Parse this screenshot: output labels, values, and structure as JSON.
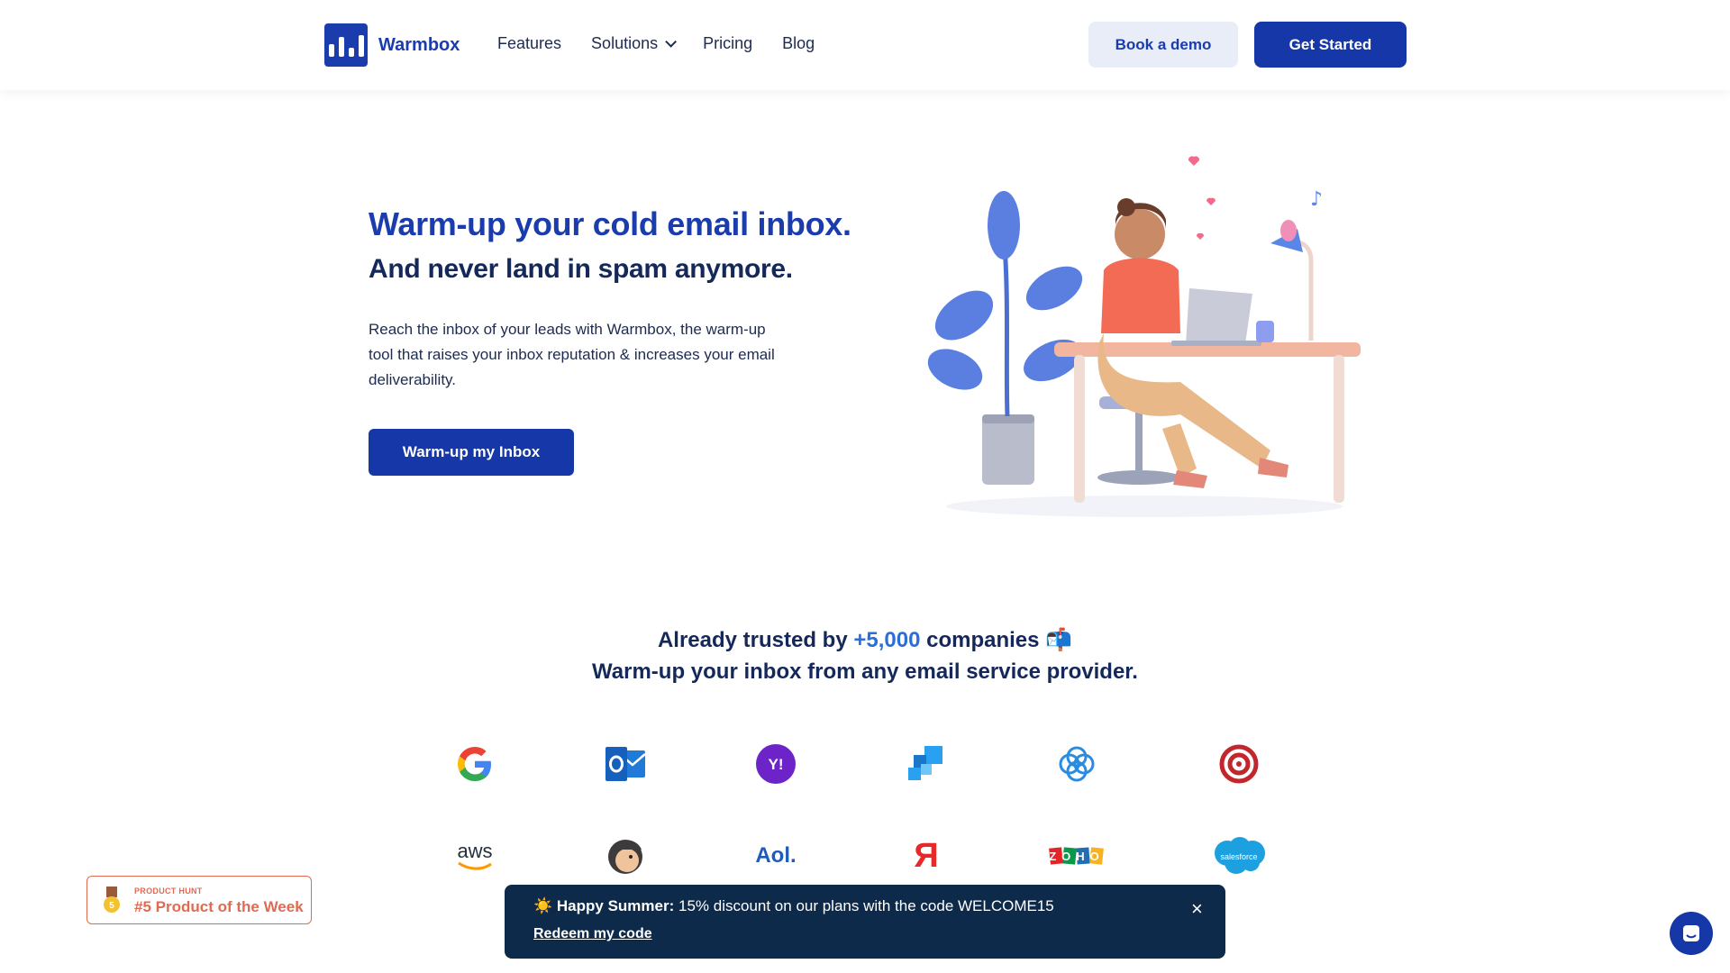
{
  "header": {
    "logo_text": "Warmbox",
    "nav": [
      {
        "label": "Features"
      },
      {
        "label": "Solutions"
      },
      {
        "label": "Pricing"
      },
      {
        "label": "Blog"
      }
    ],
    "book_demo": "Book a demo",
    "get_started": "Get Started"
  },
  "hero": {
    "title": "Warm-up your cold email inbox.",
    "subtitle": "And never land in spam anymore.",
    "body": "Reach the inbox of your leads with Warmbox, the warm-up tool that raises your inbox reputation & increases your email deliverability.",
    "cta": "Warm-up my Inbox"
  },
  "trusted": {
    "prefix": "Already trusted by",
    "highlight": "+5,000",
    "suffix": "companies 📬",
    "line2": "Warm-up your inbox from any email service provider."
  },
  "providers": [
    {
      "name": "google-icon"
    },
    {
      "name": "outlook-icon"
    },
    {
      "name": "yahoo-icon",
      "text": "Y!"
    },
    {
      "name": "sendinblue-icon"
    },
    {
      "name": "sendgrid-icon"
    },
    {
      "name": "target-icon"
    },
    {
      "name": "aws-icon",
      "text": "aws"
    },
    {
      "name": "mailchimp-icon"
    },
    {
      "name": "aol-icon",
      "text": "Aol."
    },
    {
      "name": "yandex-icon",
      "text": "Я"
    },
    {
      "name": "zoho-icon",
      "text": "ZOHO"
    },
    {
      "name": "salesforce-icon",
      "text": "salesforce"
    }
  ],
  "product_hunt": {
    "small": "PRODUCT HUNT",
    "big": "#5 Product of the Week"
  },
  "banner": {
    "emoji": "☀️",
    "bold": "Happy Summer:",
    "text": "15% discount on our plans with the code WELCOME15",
    "link": "Redeem my code",
    "close": "×"
  },
  "colors": {
    "brand_blue": "#1a3cad",
    "dark_navy": "#14285a",
    "banner_bg": "#0e2a4a",
    "accent_orange": "#e36a52"
  }
}
